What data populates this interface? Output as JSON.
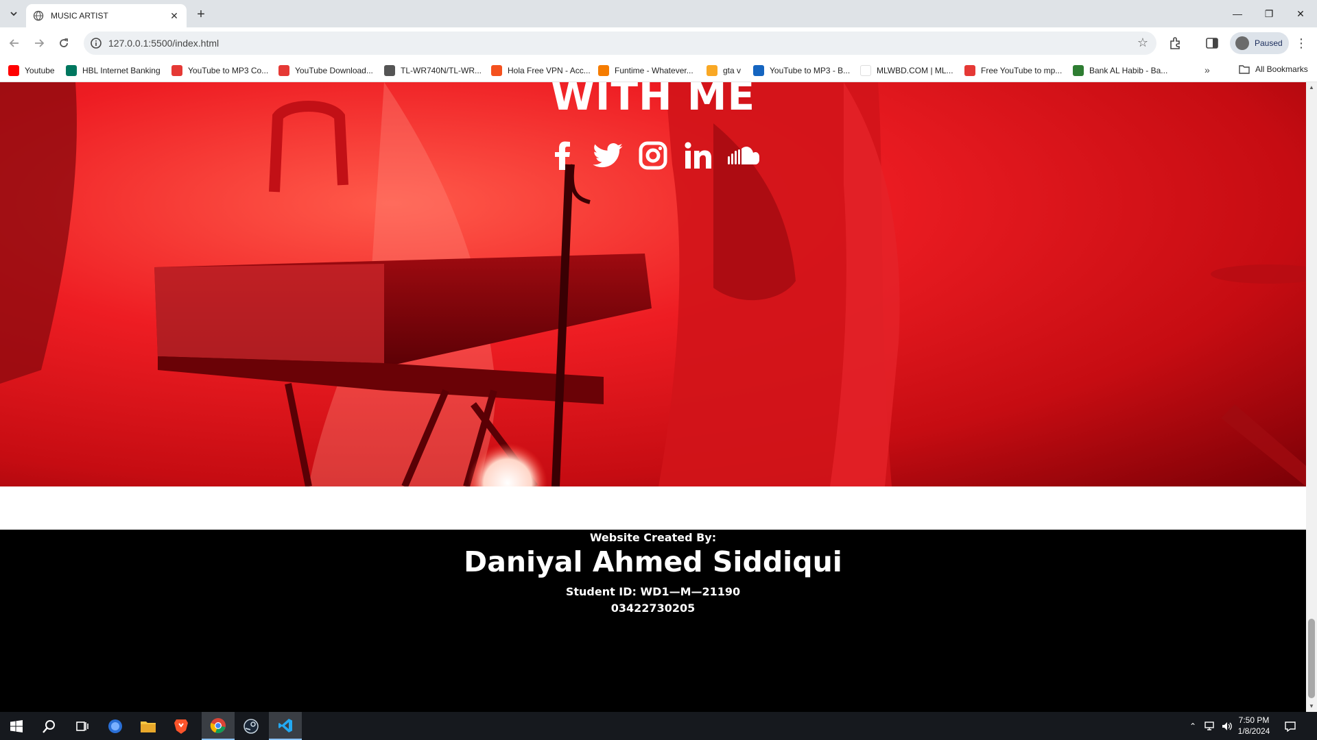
{
  "browser": {
    "tab_title": "MUSIC ARTIST",
    "url": "127.0.0.1:5500/index.html",
    "profile_label": "Paused",
    "all_bookmarks_label": "All Bookmarks",
    "bookmarks": [
      {
        "label": "Youtube",
        "color": "#ff0000"
      },
      {
        "label": "HBL Internet Banking",
        "color": "#00775f"
      },
      {
        "label": "YouTube to MP3 Co...",
        "color": "#e53935"
      },
      {
        "label": "YouTube Download...",
        "color": "#e53935"
      },
      {
        "label": "TL-WR740N/TL-WR...",
        "color": "#555555"
      },
      {
        "label": "Hola Free VPN - Acc...",
        "color": "#f4511e"
      },
      {
        "label": "Funtime - Whatever...",
        "color": "#f57c00"
      },
      {
        "label": "gta v",
        "color": "#f9a825"
      },
      {
        "label": "YouTube to MP3 - B...",
        "color": "#1565c0"
      },
      {
        "label": "MLWBD.COM | ML...",
        "color": "#ffffff"
      },
      {
        "label": "Free YouTube to mp...",
        "color": "#e53935"
      },
      {
        "label": "Bank AL Habib - Ba...",
        "color": "#2e7d32"
      }
    ]
  },
  "page": {
    "hero_title": "WITH ME",
    "socials": [
      "facebook-icon",
      "twitter-icon",
      "instagram-icon",
      "linkedin-icon",
      "soundcloud-icon"
    ],
    "accent_color": "#ee1d23",
    "footer": {
      "created_by": "Website Created By:",
      "name": "Daniyal Ahmed Siddiqui",
      "student_id": "Student ID: WD1—M—21190",
      "phone": "03422730205"
    }
  },
  "taskbar": {
    "time": "7:50 PM",
    "date": "1/8/2024"
  }
}
